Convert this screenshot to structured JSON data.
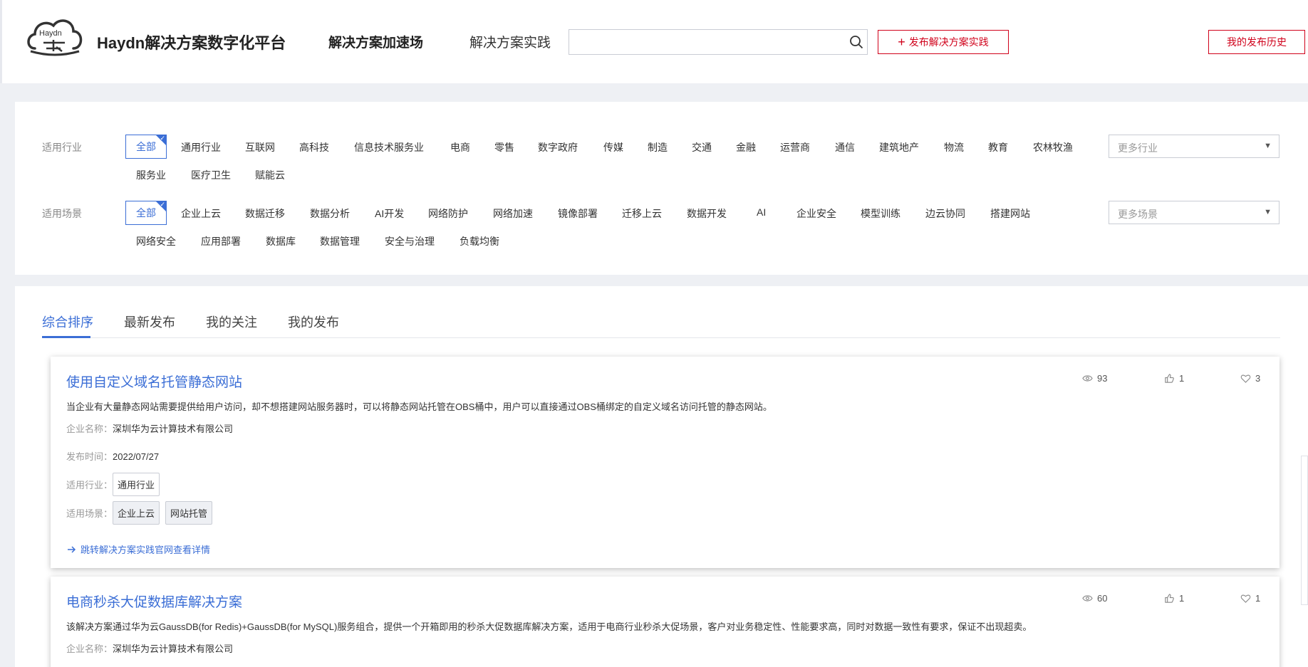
{
  "header": {
    "logo_text": "Haydn",
    "brand": "Haydn解决方案数字化平台",
    "nav": [
      "解决方案加速场",
      "解决方案实践"
    ],
    "search": {
      "value": "",
      "placeholder": ""
    },
    "publish_button": "发布解决方案实践",
    "history_button": "我的发布历史"
  },
  "filters": {
    "industry": {
      "label": "适用行业",
      "items": [
        "全部",
        "通用行业",
        "互联网",
        "高科技",
        "信息技术服务业",
        "电商",
        "零售",
        "数字政府",
        "传媒",
        "制造",
        "交通",
        "金融",
        "运营商",
        "通信",
        "建筑地产",
        "物流",
        "教育",
        "农林牧渔",
        "服务业",
        "医疗卫生",
        "赋能云"
      ],
      "more": "更多行业"
    },
    "scene": {
      "label": "适用场景",
      "items": [
        "全部",
        "企业上云",
        "数据迁移",
        "数据分析",
        "AI开发",
        "网络防护",
        "网络加速",
        "镜像部署",
        "迁移上云",
        "数据开发",
        "AI",
        "企业安全",
        "模型训练",
        "边云协同",
        "搭建网站",
        "网络安全",
        "应用部署",
        "数据库",
        "数据管理",
        "安全与治理",
        "负载均衡"
      ],
      "more": "更多场景"
    }
  },
  "tabs": [
    "综合排序",
    "最新发布",
    "我的关注",
    "我的发布"
  ],
  "cards": [
    {
      "title": "使用自定义域名托管静态网站",
      "desc": "当企业有大量静态网站需要提供给用户访问，却不想搭建网站服务器时，可以将静态网站托管在OBS桶中，用户可以直接通过OBS桶绑定的自定义域名访问托管的静态网站。",
      "company_label": "企业名称：",
      "company": "深圳华为云计算技术有限公司",
      "date_label": "发布时间：",
      "date": "2022/07/27",
      "industry_label": "适用行业：",
      "industries": [
        "通用行业"
      ],
      "scene_label": "适用场景：",
      "scenes": [
        "企业上云",
        "网站托管"
      ],
      "link": "跳转解决方案实践官网查看详情",
      "views": "93",
      "likes": "1",
      "favs": "3"
    },
    {
      "title": "电商秒杀大促数据库解决方案",
      "desc": "该解决方案通过华为云GaussDB(for Redis)+GaussDB(for MySQL)服务组合，提供一个开箱即用的秒杀大促数据库解决方案，适用于电商行业秒杀大促场景，客户对业务稳定性、性能要求高，同时对数据一致性有要求，保证不出现超卖。",
      "company_label": "企业名称：",
      "company": "深圳华为云计算技术有限公司",
      "views": "60",
      "likes": "1",
      "favs": "1"
    }
  ],
  "colors": {
    "accent": "#3b6ed6",
    "brand_red": "#d0021b"
  }
}
